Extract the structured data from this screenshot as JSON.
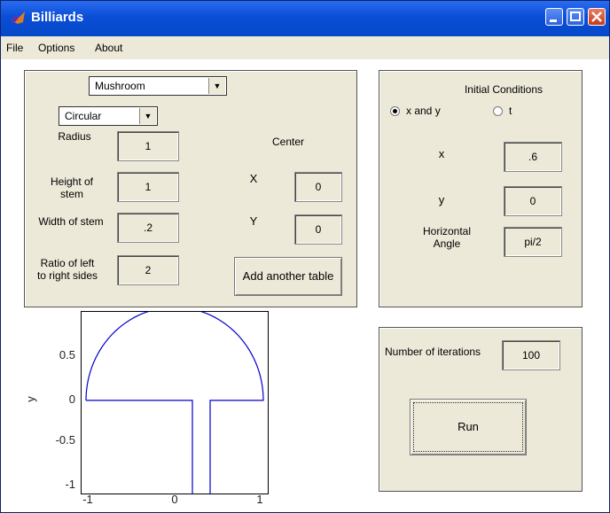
{
  "window": {
    "title": "Billiards"
  },
  "menu": [
    "File",
    "Options",
    "About"
  ],
  "table": {
    "shape_select": "Mushroom",
    "cap_select": "Circular",
    "radius_label": "Radius",
    "radius_value": "1",
    "stem_height_label_1": "Height of",
    "stem_height_label_2": "stem",
    "stem_height_value": "1",
    "stem_width_label": "Width of stem",
    "stem_width_value": ".2",
    "ratio_label_1": "Ratio of left",
    "ratio_label_2": "to right sides",
    "ratio_value": "2",
    "center_label": "Center",
    "x_label": "X",
    "x_value": "0",
    "y_label": "Y",
    "y_value": "0",
    "add_table_button": "Add another table"
  },
  "initial_conditions": {
    "title": "Initial Conditions",
    "option_xy": "x and y",
    "option_t": "t",
    "selected": "x and y",
    "x_label": "x",
    "x_value": ".6",
    "y_label": "y",
    "y_value": "0",
    "angle_label_1": "Horizontal",
    "angle_label_2": "Angle",
    "angle_value": "pi/2"
  },
  "run_panel": {
    "iterations_label": "Number of iterations",
    "iterations_value": "100",
    "run_button": "Run"
  },
  "plot": {
    "ylabel": "y",
    "x_ticks": [
      "-1",
      "0",
      "1"
    ],
    "y_ticks": [
      "0.5",
      "0",
      "-0.5",
      "-1"
    ],
    "line_color": "#0000cc"
  }
}
